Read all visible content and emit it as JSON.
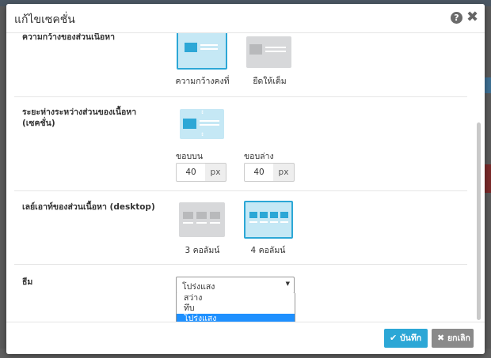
{
  "modal": {
    "title": "แก้ไขเซคชั่น",
    "help_icon": "?",
    "close_icon": "✖"
  },
  "width_section": {
    "label": "ความกว้างของส่วนเนื้อหา",
    "options": [
      {
        "caption": "ความกว้างคงที่",
        "selected": true
      },
      {
        "caption": "ยืดให้เต็ม",
        "selected": false
      }
    ]
  },
  "spacing_section": {
    "label_line1": "ระยะห่างระหว่างส่วนของเนื้อหา",
    "label_line2": "(เซคชั่น)",
    "top_label": "ขอบบน",
    "top_value": "40",
    "bottom_label": "ขอบล่าง",
    "bottom_value": "40",
    "unit": "px"
  },
  "layout_section": {
    "label": "เลย์เอาท์ของส่วนเนื้อหา (desktop)",
    "options": [
      {
        "caption": "3 คอลัมน์",
        "selected": false
      },
      {
        "caption": "4 คอลัมน์",
        "selected": true
      }
    ]
  },
  "theme_section": {
    "label": "ธีม",
    "selected": "โปร่งแสง",
    "options": [
      "สว่าง",
      "ทึบ",
      "โปร่งแสง"
    ]
  },
  "footer": {
    "save_label": "บันทึก",
    "cancel_label": "ยกเลิก",
    "save_icon": "✔",
    "cancel_icon": "✖"
  },
  "colors": {
    "accent": "#2ca7d6",
    "selected_bg": "#c5e8f5",
    "dropdown_highlight": "#1e90ff",
    "cancel_button": "#8a8a8a"
  }
}
